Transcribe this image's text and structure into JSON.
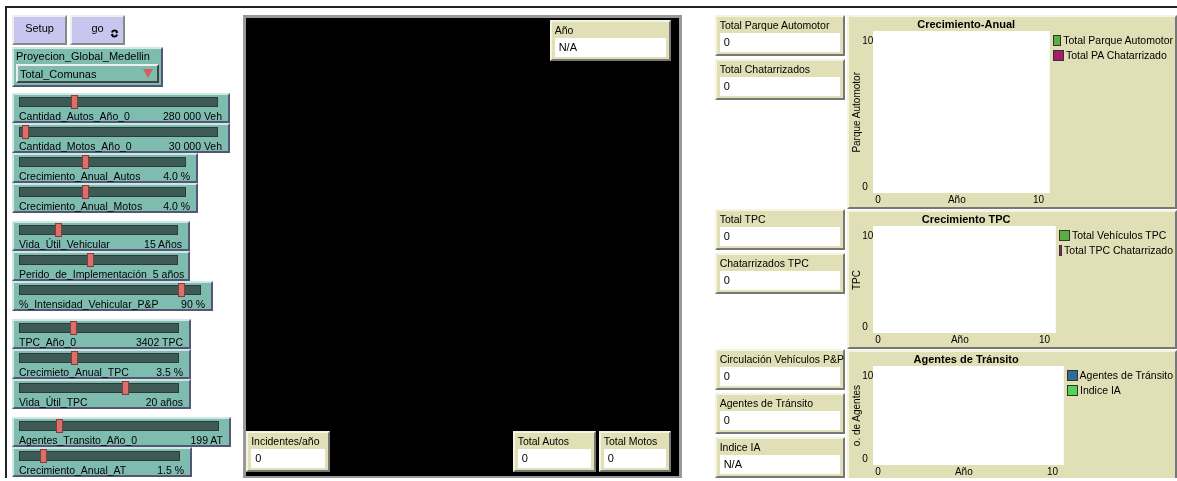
{
  "buttons": [
    {
      "label": "Setup",
      "forever": false
    },
    {
      "label": "go",
      "forever": true
    }
  ],
  "chooser": {
    "label": "Proyecion_Global_Medellin",
    "value": "Total_Comunas"
  },
  "slider_groups": [
    [
      {
        "label": "Cantidad_Autos_Año_0",
        "value": "280 000 Veh",
        "level": 0.28
      },
      {
        "label": "Cantidad_Motos_Año_0",
        "value": "30 000 Veh",
        "level": 0.03
      },
      {
        "label": "Crecimiento_Anual_Autos",
        "value": "4.0 %",
        "level": 0.4
      },
      {
        "label": "Crecimiento_Anual_Motos",
        "value": "4.0 %",
        "level": 0.4
      }
    ],
    [
      {
        "label": "Vida_Útil_Vehicular",
        "value": "15 Años",
        "level": 0.25
      },
      {
        "label": "Perido_de_Implementación",
        "value": "5 años",
        "level": 0.45
      },
      {
        "label": "%_Intensidad_Vehicular_P&P",
        "value": "90 %",
        "level": 0.9
      }
    ],
    [
      {
        "label": "TPC_Año_0",
        "value": "3402 TPC",
        "level": 0.34
      },
      {
        "label": "Crecimieto_Anual_TPC",
        "value": "3.5 %",
        "level": 0.35
      },
      {
        "label": "Vida_Útil_TPC",
        "value": "20 años",
        "level": 0.67
      }
    ],
    [
      {
        "label": "Agentes_Transito_Año_0",
        "value": "199 AT",
        "level": 0.2
      },
      {
        "label": "Crecimiento_Anual_AT",
        "value": "1.5 %",
        "level": 0.15
      }
    ]
  ],
  "view": {
    "top_monitor": {
      "label": "Año",
      "value": "N/A"
    },
    "bottom_left_monitor": {
      "label": "Incidentes/año",
      "value": "0"
    },
    "bottom_right_monitors": [
      {
        "label": "Total Autos",
        "value": "0"
      },
      {
        "label": "Total Motos",
        "value": "0"
      }
    ]
  },
  "monitor_groups": [
    [
      {
        "label": "Total Parque Automotor",
        "value": "0"
      },
      {
        "label": "Total Chatarrizados",
        "value": "0"
      }
    ],
    [
      {
        "label": "Total TPC",
        "value": "0"
      },
      {
        "label": "Chatarrizados TPC",
        "value": "0"
      }
    ],
    [
      {
        "label": "Circulación Vehículos P&P",
        "value": "0"
      },
      {
        "label": "Agentes de Tránsito",
        "value": "0"
      },
      {
        "label": "Indice IA",
        "value": "N/A"
      }
    ]
  ],
  "plots": [
    {
      "title": "Crecimiento-Anual",
      "y_axis_label": "Parque Automotor",
      "y_max_label": "10",
      "y_min_label": "0",
      "x_min_label": "0",
      "x_axis_label": "Año",
      "x_max_label": "10",
      "legend": [
        {
          "name": "Total Parque Automotor",
          "color": "#59b041"
        },
        {
          "name": "Total PA Chatarrizado",
          "color": "#a71b6a"
        }
      ]
    },
    {
      "title": "Crecimiento TPC",
      "y_axis_label": "TPC",
      "y_max_label": "10",
      "y_min_label": "0",
      "x_min_label": "0",
      "x_axis_label": "Año",
      "x_max_label": "10",
      "legend": [
        {
          "name": "Total Vehículos TPC",
          "color": "#59b041"
        },
        {
          "name": "Total TPC Chatarrizado",
          "color": "#a71b6a"
        }
      ]
    },
    {
      "title": "Agentes de Tránsito",
      "y_axis_label": "o. de Agentes",
      "y_max_label": "10",
      "y_min_label": "0",
      "x_min_label": "0",
      "x_axis_label": "Año",
      "x_max_label": "10",
      "legend": [
        {
          "name": "Agentes de Tránsito",
          "color": "#2c6e9a"
        },
        {
          "name": "Indice IA",
          "color": "#55d255"
        }
      ]
    }
  ]
}
